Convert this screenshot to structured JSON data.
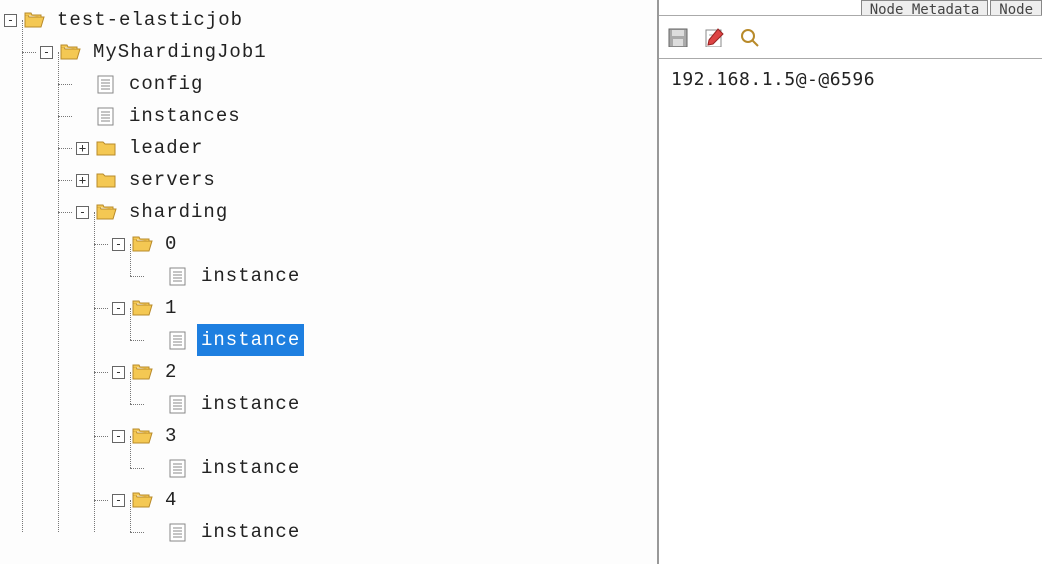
{
  "tree": {
    "root": {
      "label": "test-elasticjob",
      "children": [
        {
          "label": "MyShardingJob1",
          "expanded": true,
          "children_docs": [
            {
              "label": "config"
            },
            {
              "label": "instances"
            }
          ],
          "children_folders": [
            {
              "label": "leader",
              "expanded": false
            },
            {
              "label": "servers",
              "expanded": false
            },
            {
              "label": "sharding",
              "expanded": true,
              "children": [
                {
                  "label": "0",
                  "expanded": true,
                  "docs": [
                    {
                      "label": "instance",
                      "selected": false
                    }
                  ]
                },
                {
                  "label": "1",
                  "expanded": true,
                  "docs": [
                    {
                      "label": "instance",
                      "selected": true
                    }
                  ]
                },
                {
                  "label": "2",
                  "expanded": true,
                  "docs": [
                    {
                      "label": "instance",
                      "selected": false
                    }
                  ]
                },
                {
                  "label": "3",
                  "expanded": true,
                  "docs": [
                    {
                      "label": "instance",
                      "selected": false
                    }
                  ]
                },
                {
                  "label": "4",
                  "expanded": true,
                  "docs": [
                    {
                      "label": "instance",
                      "selected": false
                    }
                  ]
                }
              ]
            }
          ]
        }
      ]
    }
  },
  "tabs": {
    "tab1": "Node Metadata",
    "tab2": "Node"
  },
  "content": {
    "value": "192.168.1.5@-@6596"
  }
}
